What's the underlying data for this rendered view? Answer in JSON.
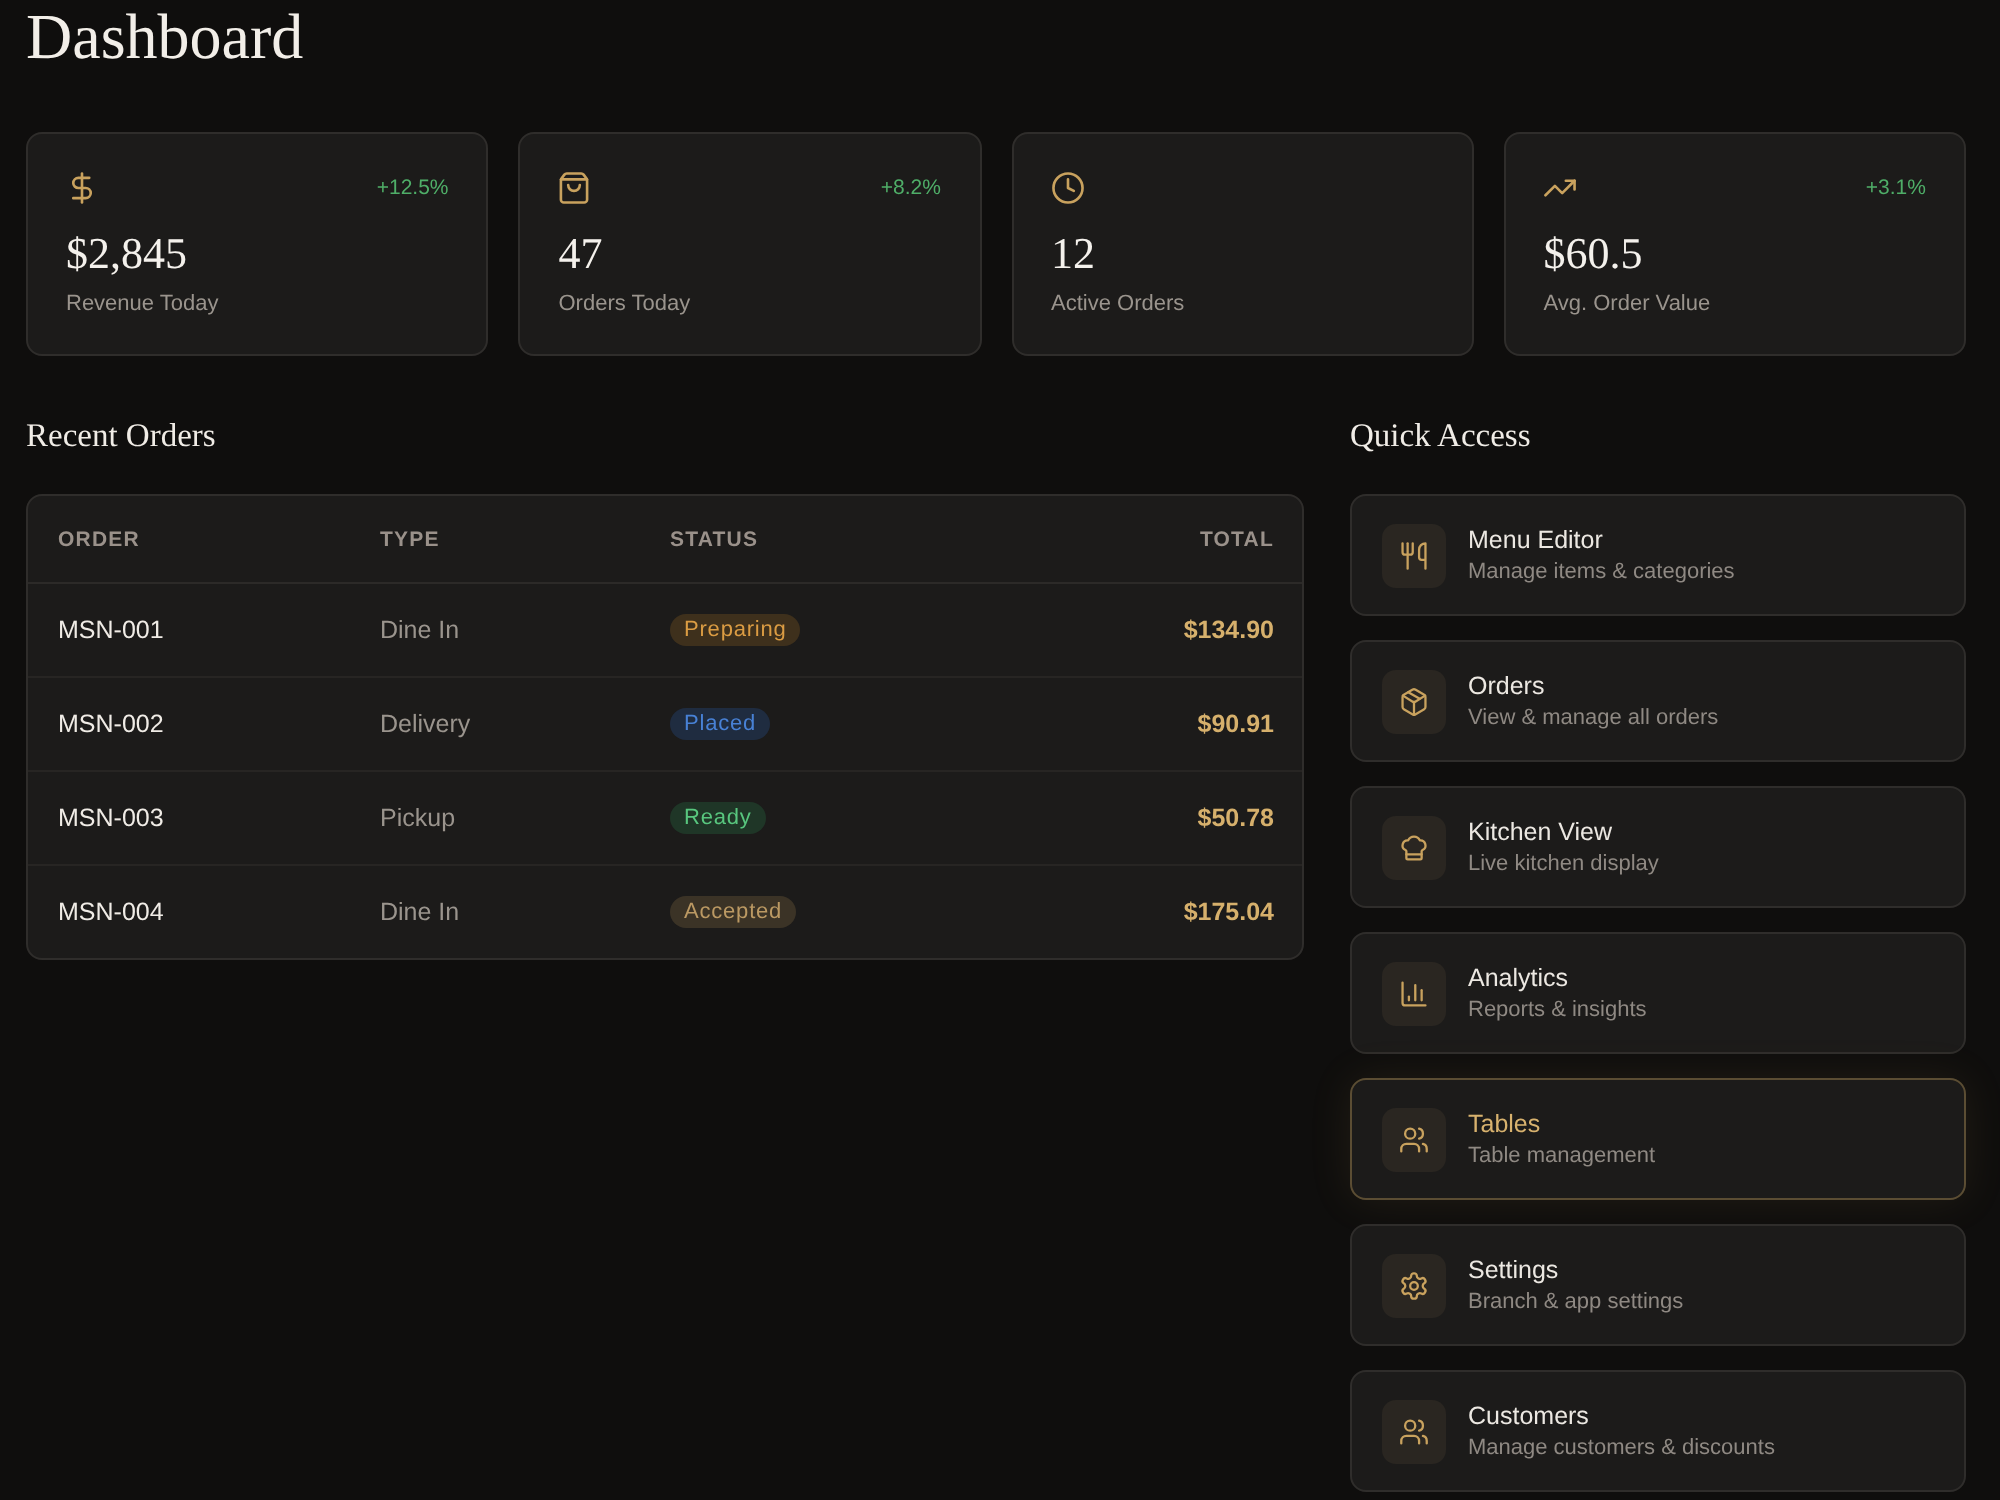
{
  "page": {
    "title": "Dashboard"
  },
  "stats": [
    {
      "value": "$2,845",
      "label": "Revenue Today",
      "change": "+12.5%"
    },
    {
      "value": "47",
      "label": "Orders Today",
      "change": "+8.2%"
    },
    {
      "value": "12",
      "label": "Active Orders"
    },
    {
      "value": "$60.5",
      "label": "Avg. Order Value",
      "change": "+3.1%"
    }
  ],
  "recent_orders": {
    "title": "Recent Orders",
    "columns": [
      "ORDER",
      "TYPE",
      "STATUS",
      "TOTAL"
    ],
    "rows": [
      {
        "order": "MSN-001",
        "type": "Dine In",
        "status": {
          "label": "Preparing",
          "color": "#3e301c"
        },
        "total": "$134.90"
      },
      {
        "order": "MSN-002",
        "type": "Delivery",
        "status": {
          "label": "Placed",
          "color": "#1f2c40"
        },
        "total": "$90.91"
      },
      {
        "order": "MSN-003",
        "type": "Pickup",
        "status": {
          "label": "Ready",
          "color": "#1f3627"
        },
        "total": "$50.78"
      },
      {
        "order": "MSN-004",
        "type": "Dine In",
        "status": {
          "label": "Accepted",
          "color": "#3b3326"
        },
        "total": "$175.04"
      }
    ]
  },
  "quick_access": {
    "title": "Quick Access",
    "items": [
      {
        "title": "Menu Editor",
        "subtitle": "Manage items & categories",
        "selected": false
      },
      {
        "title": "Orders",
        "subtitle": "View & manage all orders",
        "selected": false
      },
      {
        "title": "Kitchen View",
        "subtitle": "Live kitchen display",
        "selected": false
      },
      {
        "title": "Analytics",
        "subtitle": "Reports & insights",
        "selected": false
      },
      {
        "title": "Tables",
        "subtitle": "Table management",
        "selected": true
      },
      {
        "title": "Settings",
        "subtitle": "Branch & app settings",
        "selected": false
      },
      {
        "title": "Customers",
        "subtitle": "Manage customers & discounts",
        "selected": false
      }
    ]
  }
}
